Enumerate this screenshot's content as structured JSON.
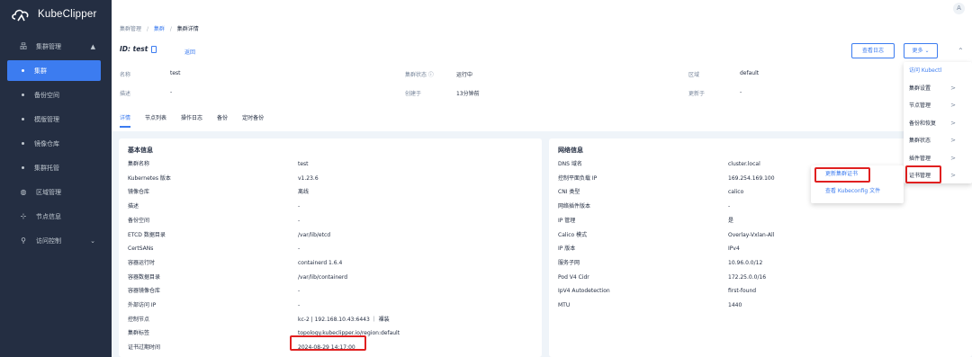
{
  "app": {
    "name": "KubeClipper"
  },
  "user": {
    "avatar_initial": "A"
  },
  "sidebar": {
    "groups": [
      {
        "label": "集群管理",
        "icon": "cluster-icon",
        "caret": "▲"
      }
    ],
    "subitems": [
      {
        "label": "集群"
      },
      {
        "label": "备份空间"
      },
      {
        "label": "模版管理"
      },
      {
        "label": "镜像仓库"
      },
      {
        "label": "集群托管"
      }
    ],
    "items": [
      {
        "label": "区域管理",
        "icon": "globe-icon"
      },
      {
        "label": "节点信息",
        "icon": "node-icon"
      },
      {
        "label": "访问控制",
        "icon": "user-icon",
        "caret": "⌄"
      }
    ]
  },
  "breadcrumb": {
    "root": "集群管理",
    "mid": "集群",
    "current": "集群详情",
    "sep": "/"
  },
  "cluster": {
    "id_label": "ID: test",
    "back": "返回",
    "btn_log": "查看日志",
    "btn_more": "更多 ⌄",
    "name_k": "名称",
    "name_v": "test",
    "status_k": "集群状态 ⓘ",
    "status_v": "运行中",
    "region_k": "区域",
    "region_v": "default",
    "desc_k": "描述",
    "desc_v": "-",
    "created_k": "创建于",
    "created_v": "13分钟前",
    "updated_k": "更新于",
    "updated_v": "-"
  },
  "tabs": [
    "详情",
    "节点列表",
    "操作日志",
    "备份",
    "定时备份"
  ],
  "basic": {
    "title": "基本信息",
    "rows": [
      {
        "k": "集群名称",
        "v": "test"
      },
      {
        "k": "Kubernetes 版本",
        "v": "v1.23.6"
      },
      {
        "k": "镜像仓库",
        "v": "离线"
      },
      {
        "k": "描述",
        "v": "-"
      },
      {
        "k": "备份空间",
        "v": "-"
      },
      {
        "k": "ETCD 数据目录",
        "v": "/var/lib/etcd"
      },
      {
        "k": "CertSANs",
        "v": "-"
      },
      {
        "k": "容器运行时",
        "v": "containerd 1.6.4"
      },
      {
        "k": "容器数据目录",
        "v": "/var/lib/containerd"
      },
      {
        "k": "容器镜像仓库",
        "v": "-"
      },
      {
        "k": "外部访问 IP",
        "v": "-"
      },
      {
        "k": "控制节点",
        "v": "kc-2 | 192.168.10.43:6443 ｜ 裸装"
      },
      {
        "k": "集群标签",
        "v": "topology.kubeclipper.io/region:default"
      },
      {
        "k": "证书过期时间",
        "v": "2024-08-29 14:17:00"
      }
    ]
  },
  "network": {
    "title": "网络信息",
    "rows": [
      {
        "k": "DNS 域名",
        "v": "cluster.local"
      },
      {
        "k": "控制平面负载 IP",
        "v": "169.254.169.100"
      },
      {
        "k": "CNI 类型",
        "v": "calico"
      },
      {
        "k": "网络插件版本",
        "v": "-"
      },
      {
        "k": "IP 管理",
        "v": "是"
      },
      {
        "k": "Calico 模式",
        "v": "Overlay-Vxlan-All"
      },
      {
        "k": "IP 版本",
        "v": "IPv4"
      },
      {
        "k": "服务子网",
        "v": "10.96.0.0/12"
      },
      {
        "k": "Pod V4 Cidr",
        "v": "172.25.0.0/16"
      },
      {
        "k": "IpV4 Autodetection",
        "v": "first-found"
      },
      {
        "k": "MTU",
        "v": "1440"
      }
    ]
  },
  "dropdown": {
    "items": [
      {
        "label": "访问 Kubectl",
        "arrow": ""
      },
      {
        "label": "集群设置",
        "arrow": ">"
      },
      {
        "label": "节点管理",
        "arrow": ">"
      },
      {
        "label": "备份和恢复",
        "arrow": ">"
      },
      {
        "label": "集群状态",
        "arrow": ">"
      },
      {
        "label": "插件管理",
        "arrow": ">"
      },
      {
        "label": "证书管理",
        "arrow": ">"
      }
    ]
  },
  "submenu": {
    "items": [
      {
        "label": "更新集群证书"
      },
      {
        "label": "查看 Kubeconfig 文件"
      }
    ]
  },
  "colors": {
    "accent": "#3c7cf0",
    "sidebar_bg": "#242e42",
    "highlight": "#e02020"
  }
}
